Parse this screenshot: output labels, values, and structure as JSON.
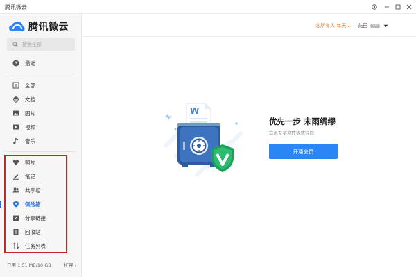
{
  "window": {
    "title": "腾讯微云"
  },
  "brand": {
    "name": "腾讯微云",
    "accent": "#2a85f5",
    "highlight": "#c0282d"
  },
  "search": {
    "placeholder": "搜索全部"
  },
  "nav": {
    "recent": "最近",
    "files": [
      {
        "label": "全部",
        "icon": "folder-icon"
      },
      {
        "label": "文档",
        "icon": "layers-icon"
      },
      {
        "label": "图片",
        "icon": "image-icon"
      },
      {
        "label": "视频",
        "icon": "play-icon"
      },
      {
        "label": "音乐",
        "icon": "music-icon"
      }
    ],
    "tools": [
      {
        "label": "照片",
        "icon": "heart-photo-icon"
      },
      {
        "label": "笔记",
        "icon": "pen-icon"
      },
      {
        "label": "共享组",
        "icon": "group-icon"
      },
      {
        "label": "保险箱",
        "icon": "shield-icon",
        "active": true
      },
      {
        "label": "分享链接",
        "icon": "share-link-icon"
      },
      {
        "label": "回收站",
        "icon": "trash-icon"
      },
      {
        "label": "任务列表",
        "icon": "transfer-icon"
      }
    ]
  },
  "storage": {
    "used": "已用 1.51 MB/10 GB",
    "expand": "扩容 ›"
  },
  "header": {
    "notice": "@所有人 每天...",
    "user": "花田",
    "vip": "VIP"
  },
  "promo": {
    "title": "优先一步 未雨绸缪",
    "subtitle": "会员专享文件极致保险",
    "button": "开通会员"
  }
}
